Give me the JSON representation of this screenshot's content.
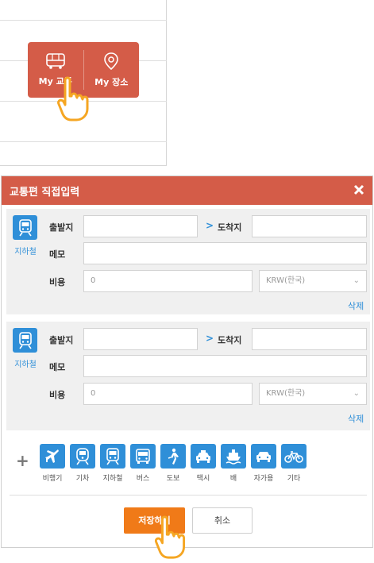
{
  "mode_switch": {
    "my_transport_label": "My 교통",
    "my_place_label": "My 장소"
  },
  "dialog": {
    "title": "교통편 직접입력",
    "segments": [
      {
        "mode_label": "지하철",
        "departure_label": "출발지",
        "departure_value": "",
        "arrow": ">",
        "arrival_label": "도착지",
        "arrival_value": "",
        "memo_label": "메모",
        "memo_value": "",
        "cost_label": "비용",
        "cost_value": "0",
        "currency": "KRW(한국)",
        "delete_label": "삭제"
      },
      {
        "mode_label": "지하철",
        "departure_label": "출발지",
        "departure_value": "",
        "arrow": ">",
        "arrival_label": "도착지",
        "arrival_value": "",
        "memo_label": "메모",
        "memo_value": "",
        "cost_label": "비용",
        "cost_value": "0",
        "currency": "KRW(한국)",
        "delete_label": "삭제"
      }
    ],
    "add_symbol": "+",
    "transport_options": [
      {
        "label": "비행기",
        "icon": "airplane-icon"
      },
      {
        "label": "기차",
        "icon": "train-icon"
      },
      {
        "label": "지하철",
        "icon": "subway-icon"
      },
      {
        "label": "버스",
        "icon": "bus-icon"
      },
      {
        "label": "도보",
        "icon": "walk-icon"
      },
      {
        "label": "택시",
        "icon": "taxi-icon"
      },
      {
        "label": "배",
        "icon": "ship-icon"
      },
      {
        "label": "자가용",
        "icon": "car-icon"
      },
      {
        "label": "기타",
        "icon": "bicycle-icon"
      }
    ],
    "save_label": "저장하기",
    "cancel_label": "취소"
  },
  "colors": {
    "header": "#d45c48",
    "accent_blue": "#2f8fd8",
    "save_orange": "#f07a18",
    "hand": "#f5a623"
  }
}
